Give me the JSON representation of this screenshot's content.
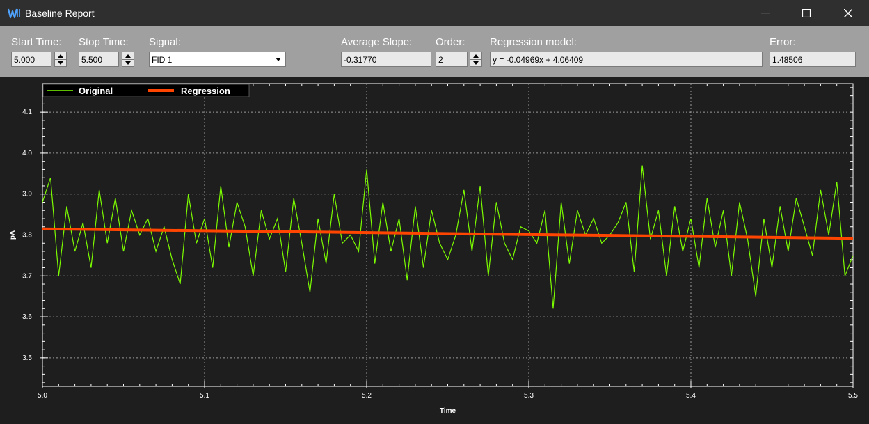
{
  "window": {
    "title": "Baseline Report",
    "icon": "waters-logo-icon",
    "controls": [
      "minimize-icon",
      "maximize-icon",
      "close-icon"
    ]
  },
  "toolbar": {
    "start_time": {
      "label": "Start Time:",
      "value": "5.000"
    },
    "stop_time": {
      "label": "Stop Time:",
      "value": "5.500"
    },
    "signal": {
      "label": "Signal:",
      "value": "FID 1"
    },
    "average_slope": {
      "label": "Average Slope:",
      "value": "-0.31770"
    },
    "order": {
      "label": "Order:",
      "value": "2"
    },
    "regression_model": {
      "label": "Regression model:",
      "value": "y = -0.04969x + 4.06409"
    },
    "error": {
      "label": "Error:",
      "value": "1.48506"
    }
  },
  "colors": {
    "titlebar": "#2f2f2f",
    "toolbar": "#a0a0a0",
    "plot_background": "#1e1e1e",
    "original_series": "#7cfc00",
    "regression_series": "#ff4500"
  },
  "chart_data": {
    "type": "line",
    "title": "",
    "xlabel": "Time",
    "ylabel": "pA",
    "xlim": [
      5.0,
      5.5
    ],
    "ylim": [
      3.43,
      4.17
    ],
    "x_ticks": [
      "5.0",
      "5.1",
      "5.2",
      "5.3",
      "5.4",
      "5.5"
    ],
    "y_ticks": [
      "3.5",
      "3.6",
      "3.7",
      "3.8",
      "3.9",
      "4.0",
      "4.1"
    ],
    "grid": true,
    "legend_position": "top-left",
    "series": [
      {
        "name": "Original",
        "x": [
          5.0,
          5.005,
          5.01,
          5.015,
          5.02,
          5.025,
          5.03,
          5.035,
          5.04,
          5.045,
          5.05,
          5.055,
          5.06,
          5.065,
          5.07,
          5.075,
          5.08,
          5.085,
          5.09,
          5.095,
          5.1,
          5.105,
          5.11,
          5.115,
          5.12,
          5.125,
          5.13,
          5.135,
          5.14,
          5.145,
          5.15,
          5.155,
          5.16,
          5.165,
          5.17,
          5.175,
          5.18,
          5.185,
          5.19,
          5.195,
          5.2,
          5.205,
          5.21,
          5.215,
          5.22,
          5.225,
          5.23,
          5.235,
          5.24,
          5.245,
          5.25,
          5.255,
          5.26,
          5.265,
          5.27,
          5.275,
          5.28,
          5.285,
          5.29,
          5.295,
          5.3,
          5.305,
          5.31,
          5.315,
          5.32,
          5.325,
          5.33,
          5.335,
          5.34,
          5.345,
          5.35,
          5.355,
          5.36,
          5.365,
          5.37,
          5.375,
          5.38,
          5.385,
          5.39,
          5.395,
          5.4,
          5.405,
          5.41,
          5.415,
          5.42,
          5.425,
          5.43,
          5.435,
          5.44,
          5.445,
          5.45,
          5.455,
          5.46,
          5.465,
          5.47,
          5.475,
          5.48,
          5.485,
          5.49,
          5.495,
          5.5
        ],
        "values": [
          3.88,
          3.94,
          3.7,
          3.87,
          3.76,
          3.83,
          3.72,
          3.91,
          3.78,
          3.89,
          3.76,
          3.86,
          3.8,
          3.84,
          3.76,
          3.82,
          3.74,
          3.68,
          3.9,
          3.78,
          3.84,
          3.72,
          3.92,
          3.77,
          3.88,
          3.82,
          3.7,
          3.86,
          3.79,
          3.84,
          3.71,
          3.89,
          3.78,
          3.66,
          3.84,
          3.73,
          3.9,
          3.78,
          3.8,
          3.76,
          3.96,
          3.73,
          3.88,
          3.76,
          3.84,
          3.69,
          3.87,
          3.72,
          3.86,
          3.78,
          3.74,
          3.8,
          3.91,
          3.76,
          3.92,
          3.7,
          3.88,
          3.78,
          3.74,
          3.82,
          3.81,
          3.78,
          3.86,
          3.62,
          3.88,
          3.73,
          3.86,
          3.8,
          3.84,
          3.78,
          3.8,
          3.83,
          3.88,
          3.71,
          3.97,
          3.79,
          3.86,
          3.7,
          3.87,
          3.76,
          3.84,
          3.72,
          3.89,
          3.77,
          3.86,
          3.7,
          3.88,
          3.79,
          3.65,
          3.84,
          3.72,
          3.87,
          3.76,
          3.89,
          3.82,
          3.75,
          3.91,
          3.8,
          3.93,
          3.7,
          3.75
        ]
      },
      {
        "name": "Regression",
        "x": [
          5.0,
          5.5
        ],
        "values": [
          3.815,
          3.792
        ]
      }
    ]
  }
}
